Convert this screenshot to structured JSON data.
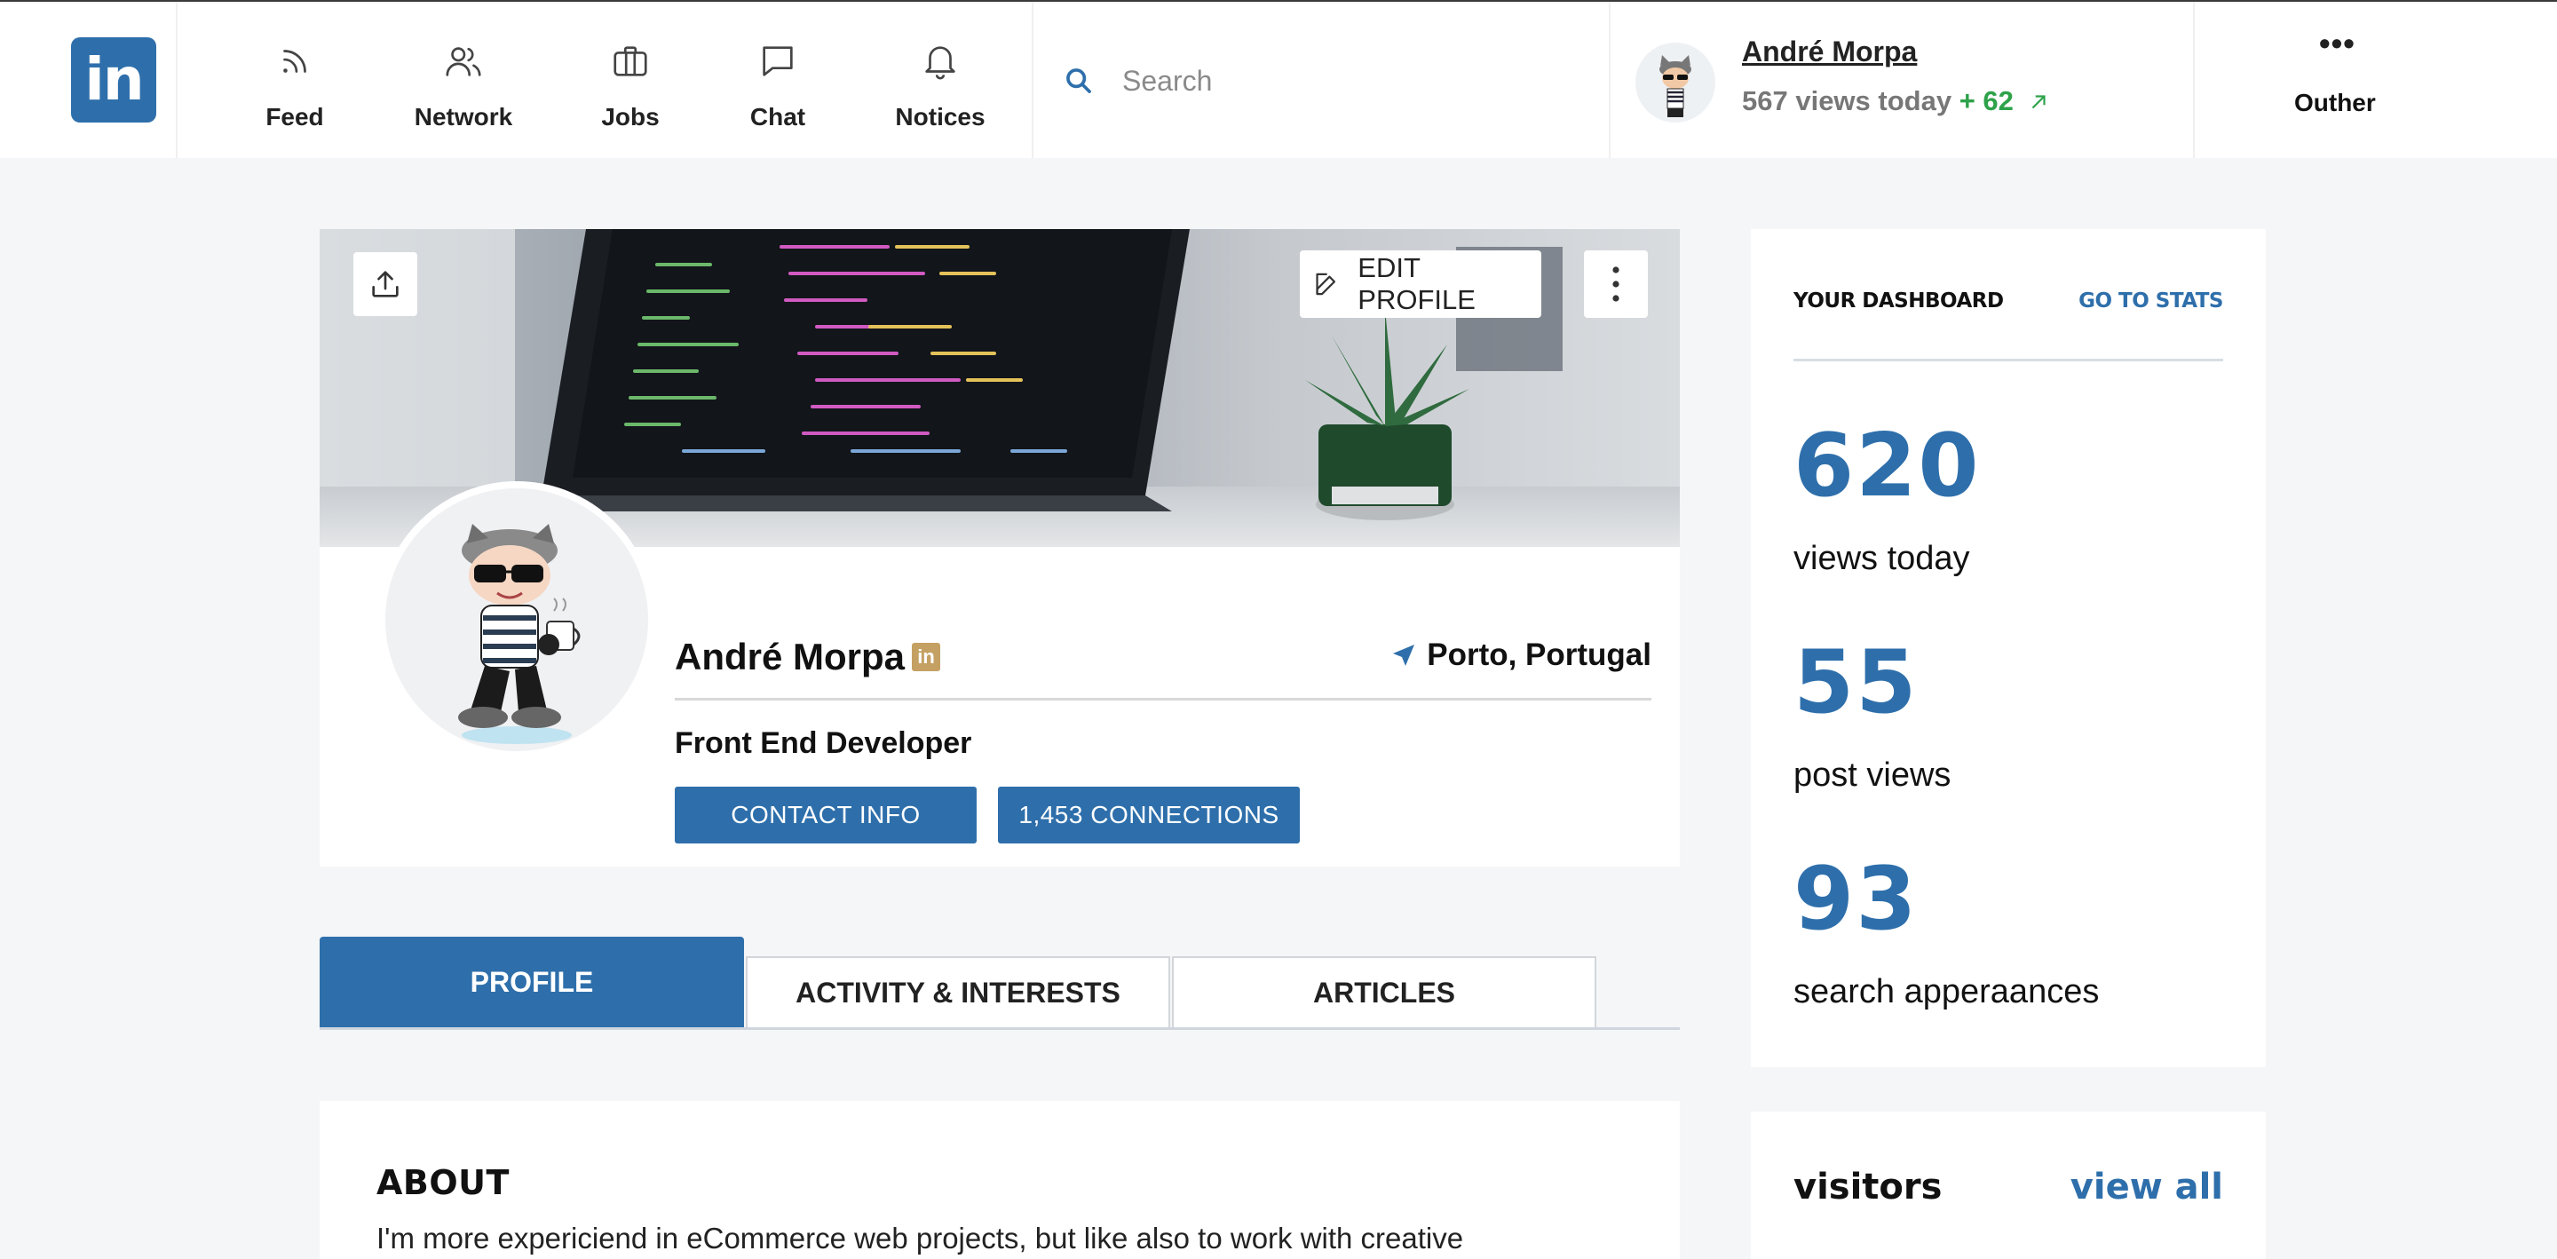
{
  "nav": {
    "logo_text": "in",
    "items": [
      {
        "label": "Feed",
        "icon": "rss-icon"
      },
      {
        "label": "Network",
        "icon": "users-icon"
      },
      {
        "label": "Jobs",
        "icon": "briefcase-icon"
      },
      {
        "label": "Chat",
        "icon": "chat-icon"
      },
      {
        "label": "Notices",
        "icon": "bell-icon"
      }
    ],
    "search_placeholder": "Search",
    "me": {
      "name": "André Morpa",
      "views_text": "567 views today",
      "views_delta": "+ 62"
    },
    "more_label": "Outher"
  },
  "profile": {
    "edit_label": "EDIT PROFILE",
    "name": "André Morpa",
    "badge": "in",
    "location": "Porto, Portugal",
    "title": "Front End Developer",
    "contact_label": "CONTACT INFO",
    "connections_label": "1,453 CONNECTIONS"
  },
  "tabs": [
    {
      "label": "PROFILE",
      "active": true
    },
    {
      "label": "ACTIVITY & INTERESTS",
      "active": false
    },
    {
      "label": "ARTICLES",
      "active": false
    }
  ],
  "about": {
    "heading": "ABOUT",
    "text": "I'm more expericiend in eCommerce web projects, but like also to work with creative"
  },
  "dashboard": {
    "heading": "YOUR DASHBOARD",
    "link": "GO TO STATS",
    "stats": [
      {
        "value": "620",
        "label": "views today"
      },
      {
        "value": "55",
        "label": "post views"
      },
      {
        "value": "93",
        "label": "search apperaances"
      }
    ]
  },
  "visitors": {
    "heading": "visitors",
    "link": "view all"
  },
  "colors": {
    "brand": "#2e6fab",
    "positive": "#2ea24a",
    "badge_gold": "#c4a063"
  }
}
